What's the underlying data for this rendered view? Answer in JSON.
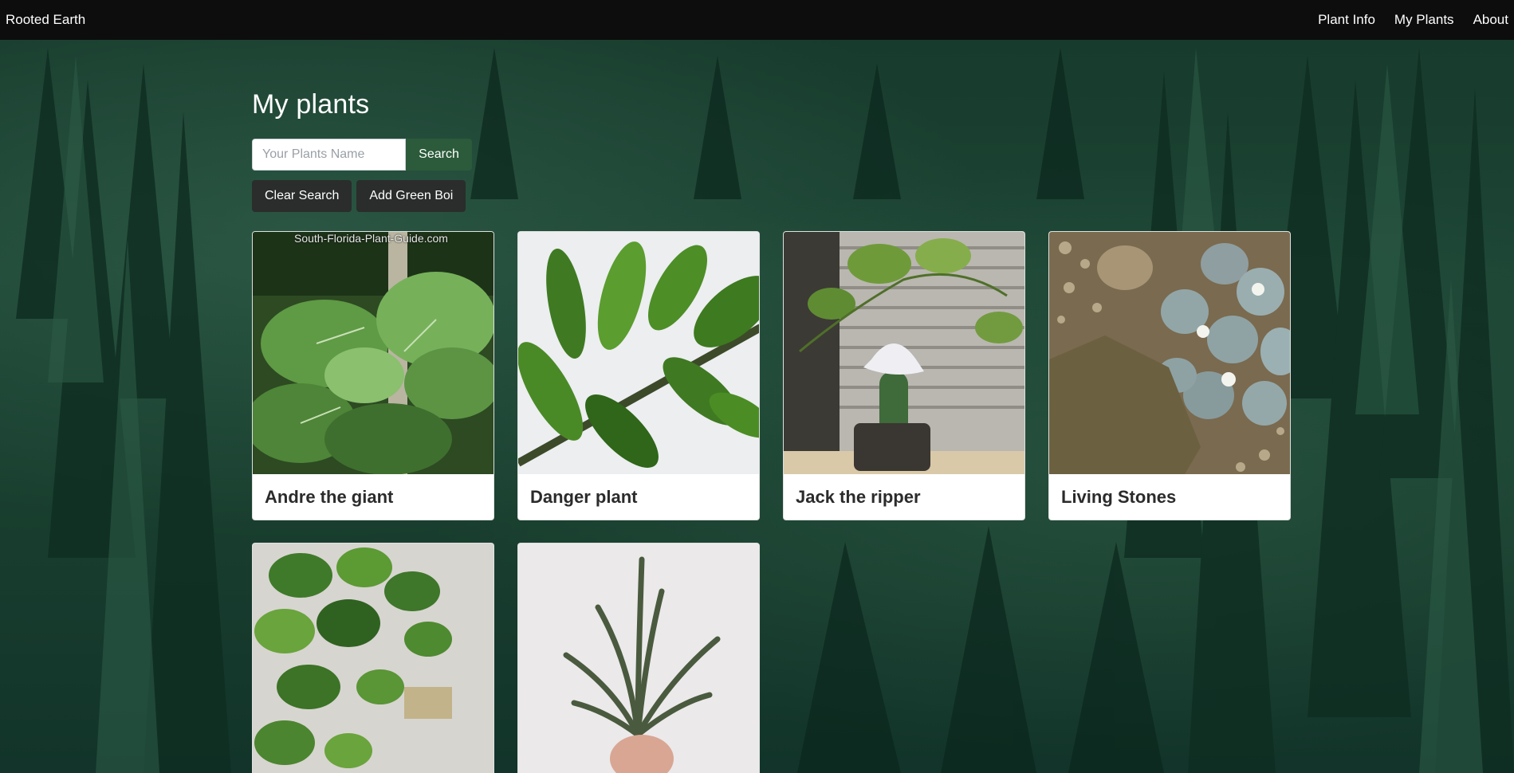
{
  "navbar": {
    "brand": "Rooted Earth",
    "links": [
      "Plant Info",
      "My Plants",
      "About"
    ]
  },
  "page": {
    "title": "My plants"
  },
  "search": {
    "placeholder": "Your Plants Name",
    "value": "",
    "button_label": "Search"
  },
  "actions": {
    "clear_label": "Clear Search",
    "add_label": "Add Green Boi"
  },
  "plants": [
    {
      "name": "Andre the giant",
      "image": "elephant-ear-plant",
      "watermark": "South-Florida-Plant-Guide.com"
    },
    {
      "name": "Danger plant",
      "image": "zz-plant"
    },
    {
      "name": "Jack the ripper",
      "image": "cactus-with-hat"
    },
    {
      "name": "Living Stones",
      "image": "lithops"
    },
    {
      "name": "",
      "image": "pothos-plant"
    },
    {
      "name": "",
      "image": "air-plant"
    }
  ],
  "colors": {
    "navbar_bg": "#0d0d0d",
    "search_button": "#2b5b3a",
    "secondary_button": "#2a2d2b"
  }
}
